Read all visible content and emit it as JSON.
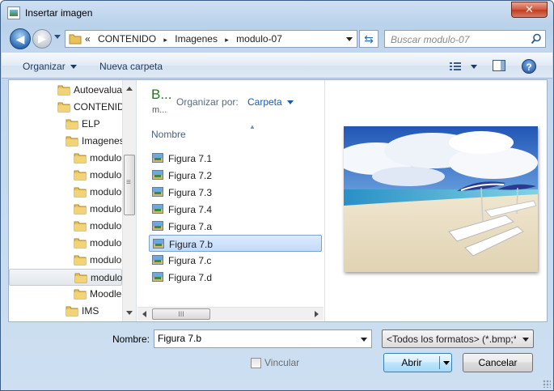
{
  "window": {
    "title": "Insertar imagen",
    "close_symbol": "✕"
  },
  "nav": {
    "back_symbol": "◀",
    "forward_symbol": "▶",
    "refresh_symbol": "⇆"
  },
  "address": {
    "overflow": "«",
    "crumbs": [
      "CONTENIDO",
      "Imagenes",
      "modulo-07"
    ],
    "separator": "▸"
  },
  "search": {
    "placeholder": "Buscar modulo-07"
  },
  "toolbar": {
    "organize_label": "Organizar",
    "new_folder_label": "Nueva carpeta",
    "help_symbol": "?"
  },
  "tree": {
    "items": [
      {
        "label": "Autoevalua",
        "indent": 0
      },
      {
        "label": "CONTENIDO",
        "indent": 0
      },
      {
        "label": "ELP",
        "indent": 1
      },
      {
        "label": "Imagenes",
        "indent": 1
      },
      {
        "label": "modulo",
        "indent": 2
      },
      {
        "label": "modulo",
        "indent": 2
      },
      {
        "label": "modulo",
        "indent": 2
      },
      {
        "label": "modulo",
        "indent": 2
      },
      {
        "label": "modulo",
        "indent": 2
      },
      {
        "label": "modulo",
        "indent": 2
      },
      {
        "label": "modulo",
        "indent": 2
      },
      {
        "label": "modulo",
        "indent": 2,
        "selected": true
      },
      {
        "label": "Moodle",
        "indent": 2
      },
      {
        "label": "IMS",
        "indent": 1
      }
    ]
  },
  "library": {
    "title": "B...",
    "subtitle": "m...",
    "arrange_label": "Organizar por:",
    "arrange_value": "Carpeta",
    "column_name": "Nombre"
  },
  "files": [
    {
      "name": "Figura 7.1"
    },
    {
      "name": "Figura 7.2"
    },
    {
      "name": "Figura 7.3"
    },
    {
      "name": "Figura 7.4"
    },
    {
      "name": "Figura 7.a"
    },
    {
      "name": "Figura 7.b",
      "selected": true
    },
    {
      "name": "Figura 7.c"
    },
    {
      "name": "Figura 7.d"
    }
  ],
  "footer": {
    "name_label": "Nombre:",
    "name_value": "Figura 7.b",
    "filter_value": "<Todos los formatos> (*.bmp;*",
    "link_label": "Vincular",
    "open_label": "Abrir",
    "cancel_label": "Cancelar"
  },
  "colors": {
    "accent": "#1e5aa8",
    "library_title": "#1e7a1e",
    "selection": "#c1dbfc"
  }
}
